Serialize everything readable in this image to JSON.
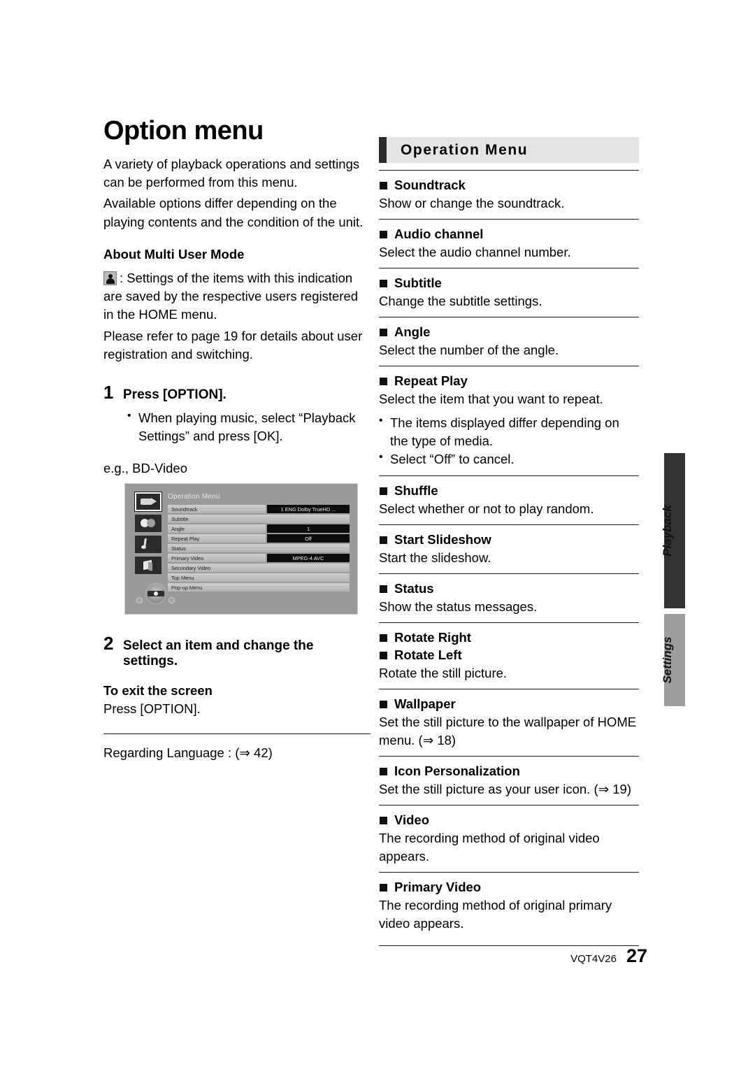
{
  "left": {
    "title": "Option menu",
    "intro": [
      "A variety of playback operations and settings can be performed from this menu.",
      "Available options differ depending on the playing contents and the condition of the unit."
    ],
    "multi_user_heading": "About Multi User Mode",
    "multi_user_text": ": Settings of the items with this indication are saved by the respective users registered in the HOME menu.",
    "multi_user_text2": "Please refer to page 19 for details about user registration and switching.",
    "step1": {
      "num": "1",
      "text": "Press [OPTION].",
      "bullets": [
        "When playing music, select “Playback Settings” and press [OK]."
      ]
    },
    "eg_label": "e.g., BD-Video",
    "step2": {
      "num": "2",
      "text": "Select an item and change the settings."
    },
    "exit_heading": "To exit the screen",
    "exit_text": "Press [OPTION].",
    "regarding": "Regarding Language : (⇒ 42)"
  },
  "tv": {
    "title": "Operation Menu",
    "icons": [
      "video-icon",
      "subtitle-icon",
      "audio-note-icon",
      "cube-3d-icon"
    ],
    "rows": [
      {
        "label": "Soundtrack",
        "value": "1 ENG Dolby TrueHD    ..."
      },
      {
        "label": "Subtitle",
        "value": null
      },
      {
        "label": "Angle",
        "value": "1"
      },
      {
        "label": "Repeat Play",
        "value": "Off"
      },
      {
        "label": "Status",
        "value": null
      },
      {
        "label": "Primary Video",
        "value": "MPEG-4 AVC"
      },
      {
        "label": "Secondary Video",
        "value": null
      },
      {
        "label": "Top Menu",
        "value": null
      },
      {
        "label": "Pop-up Menu",
        "value": null
      }
    ]
  },
  "right": {
    "header": "Operation Menu",
    "entries": [
      {
        "title": "Soundtrack",
        "desc": "Show or change the soundtrack."
      },
      {
        "title": "Audio channel",
        "desc": "Select the audio channel number."
      },
      {
        "title": "Subtitle",
        "desc": "Change the subtitle settings."
      },
      {
        "title": "Angle",
        "desc": "Select the number of the angle."
      },
      {
        "title": "Repeat Play",
        "desc": "Select the item that you want to repeat.",
        "bullets": [
          "The items displayed differ depending on the type of media.",
          "Select “Off” to cancel."
        ]
      },
      {
        "title": "Shuffle",
        "desc": "Select whether or not to play random."
      },
      {
        "title": "Start Slideshow",
        "desc": "Start the slideshow."
      },
      {
        "title": "Status",
        "desc": "Show the status messages."
      },
      {
        "title": "Rotate Right",
        "title2": "Rotate Left",
        "desc": "Rotate the still picture."
      },
      {
        "title": "Wallpaper",
        "desc": "Set the still picture to the wallpaper of HOME menu. (⇒ 18)"
      },
      {
        "title": "Icon Personalization",
        "desc": "Set the still picture as your user icon. (⇒ 19)"
      },
      {
        "title": "Video",
        "desc": "The recording method of original video appears."
      },
      {
        "title": "Primary Video",
        "desc": "The recording method of original primary video appears."
      }
    ]
  },
  "vtabs": [
    {
      "label": "Playback",
      "color": "#333333"
    },
    {
      "label": "Settings",
      "color": "#9f9f9f"
    }
  ],
  "footer": {
    "code": "VQT4V26",
    "page": "27"
  }
}
